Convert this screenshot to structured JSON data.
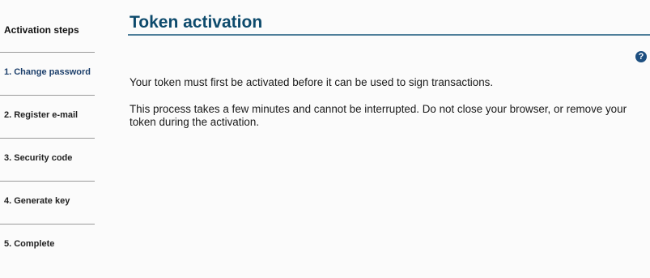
{
  "sidebar": {
    "title": "Activation steps",
    "steps": [
      {
        "label": "1. Change password",
        "active": true
      },
      {
        "label": "2. Register e-mail",
        "active": false
      },
      {
        "label": "3. Security code",
        "active": false
      },
      {
        "label": "4. Generate key",
        "active": false
      },
      {
        "label": "5. Complete",
        "active": false
      }
    ]
  },
  "main": {
    "title": "Token activation",
    "help_icon": "question-mark",
    "paragraphs": [
      "Your token must first be activated before it can be used to sign transactions.",
      "This process takes a few minutes and cannot be interrupted. Do not close your browser, or remove your token during the activation."
    ]
  },
  "colors": {
    "title": "#0d4a6c",
    "active_step": "#1c3f6b",
    "help_icon_bg": "#1d4f80"
  }
}
